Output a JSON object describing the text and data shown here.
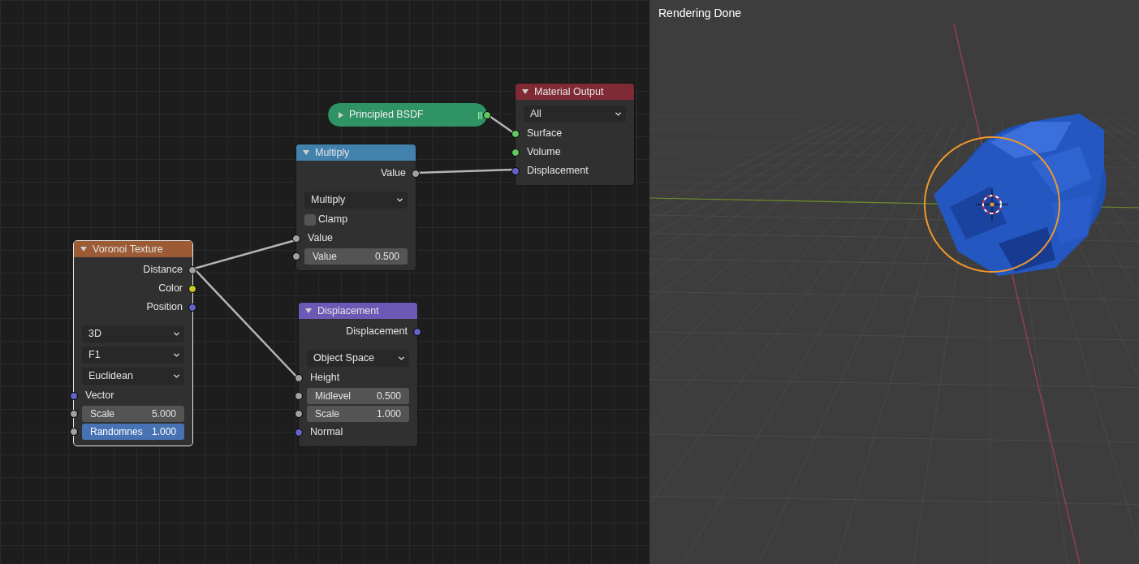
{
  "node_editor": {
    "nodes": [
      {
        "title": "Principled BSDF",
        "color": "#2f9366",
        "collapsed": true,
        "selected": false,
        "rows": [
          {
            "kind": "output",
            "color": "#63c763"
          }
        ]
      },
      {
        "title": "Material Output",
        "color": "#7f2a34",
        "collapsed": false,
        "selected": false,
        "rows": [
          {
            "kind": "dropdown",
            "value": "All"
          },
          {
            "kind": "input",
            "label": "Surface",
            "color": "#63c763"
          },
          {
            "kind": "input",
            "label": "Volume",
            "color": "#63c763"
          },
          {
            "kind": "input",
            "label": "Displacement",
            "color": "#6363c7"
          }
        ]
      },
      {
        "title": "Multiply",
        "color": "#4381ad",
        "collapsed": false,
        "selected": false,
        "rows": [
          {
            "kind": "output",
            "label": "Value",
            "color": "#a1a1a1"
          },
          {
            "kind": "dropdown",
            "value": "Multiply"
          },
          {
            "kind": "checkbox",
            "label": "Clamp",
            "checked": false
          },
          {
            "kind": "input",
            "label": "Value",
            "color": "#a1a1a1"
          },
          {
            "kind": "field",
            "label": "Value",
            "value": "0.500",
            "color": "#a1a1a1",
            "selected": false
          }
        ]
      },
      {
        "title": "Voronoi Texture",
        "color": "#9c5b34",
        "collapsed": false,
        "selected": true,
        "rows": [
          {
            "kind": "output",
            "label": "Distance",
            "color": "#a1a1a1"
          },
          {
            "kind": "output",
            "label": "Color",
            "color": "#c7c729"
          },
          {
            "kind": "output",
            "label": "Position",
            "color": "#6363c7"
          },
          {
            "kind": "dropdown",
            "value": "3D"
          },
          {
            "kind": "dropdown",
            "value": "F1"
          },
          {
            "kind": "dropdown",
            "value": "Euclidean"
          },
          {
            "kind": "input",
            "label": "Vector",
            "color": "#6363c7"
          },
          {
            "kind": "field",
            "label": "Scale",
            "value": "5.000",
            "color": "#a1a1a1",
            "selected": false
          },
          {
            "kind": "field",
            "label": "Randomnes",
            "value": "1.000",
            "color": "#a1a1a1",
            "selected": true
          }
        ]
      },
      {
        "title": "Displacement",
        "color": "#6c58b5",
        "collapsed": false,
        "selected": false,
        "rows": [
          {
            "kind": "output",
            "label": "Displacement",
            "color": "#6363c7"
          },
          {
            "kind": "dropdown",
            "value": "Object Space"
          },
          {
            "kind": "input",
            "label": "Height",
            "color": "#a1a1a1"
          },
          {
            "kind": "field",
            "label": "Midlevel",
            "value": "0.500",
            "color": "#a1a1a1",
            "selected": false
          },
          {
            "kind": "field",
            "label": "Scale",
            "value": "1.000",
            "color": "#a1a1a1",
            "selected": false
          },
          {
            "kind": "input",
            "label": "Normal",
            "color": "#6363c7"
          }
        ]
      }
    ]
  },
  "viewport": {
    "status": "Rendering Done"
  }
}
